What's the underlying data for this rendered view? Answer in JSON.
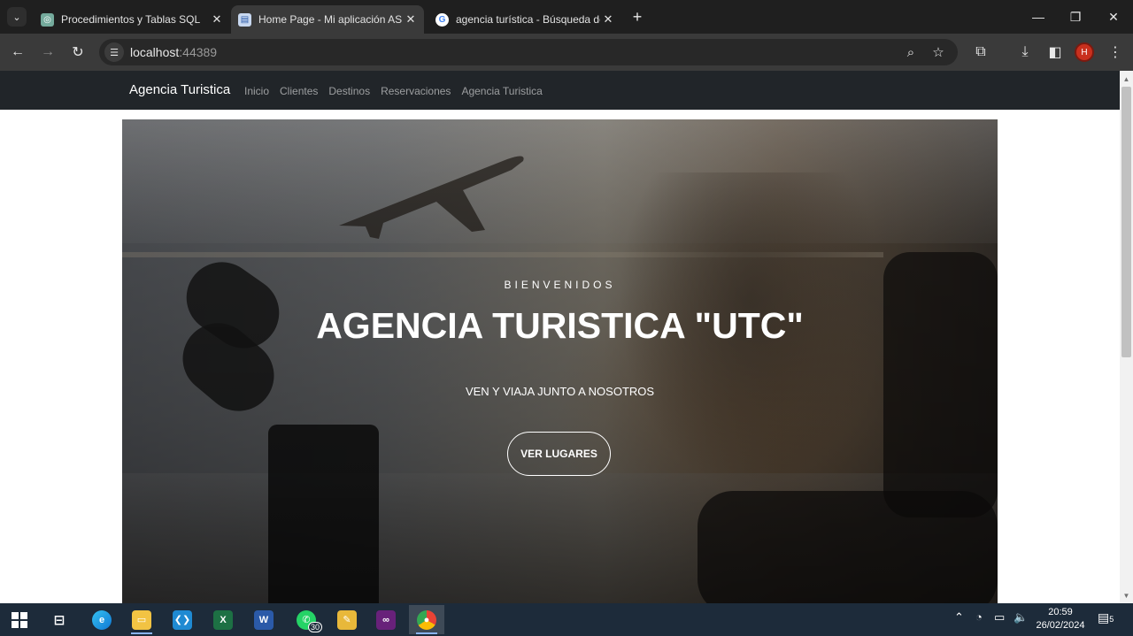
{
  "browser": {
    "tabs": [
      {
        "title": "Procedimientos y Tablas SQL",
        "favicon": "chatgpt-icon",
        "active": false
      },
      {
        "title": "Home Page - Mi aplicación ASP",
        "favicon": "page-icon",
        "active": true
      },
      {
        "title": "agencia turística - Búsqueda de",
        "favicon": "google-icon",
        "active": false
      }
    ],
    "close_glyph": "✕",
    "new_tab_glyph": "+",
    "address": {
      "host": "localhost",
      "port": ":44389"
    },
    "profile_initial": "H"
  },
  "site": {
    "brand": "Agencia Turistica",
    "nav": [
      "Inicio",
      "Clientes",
      "Destinos",
      "Reservaciones",
      "Agencia Turistica"
    ]
  },
  "hero": {
    "kicker": "BIENVENIDOS",
    "title": "AGENCIA TURISTICA \"UTC\"",
    "subtitle": "VEN Y VIAJA JUNTO A NOSOTROS",
    "cta": "VER LUGARES"
  },
  "taskbar": {
    "apps": [
      {
        "name": "task-view",
        "label": ""
      },
      {
        "name": "edge",
        "label": ""
      },
      {
        "name": "file-explorer",
        "label": ""
      },
      {
        "name": "vscode",
        "label": ""
      },
      {
        "name": "excel",
        "label": "X"
      },
      {
        "name": "word",
        "label": "W"
      },
      {
        "name": "whatsapp",
        "label": "",
        "badge": "30"
      },
      {
        "name": "sticky-app",
        "label": ""
      },
      {
        "name": "visual-studio",
        "label": ""
      },
      {
        "name": "chrome",
        "label": ""
      }
    ],
    "time": "20:59",
    "date": "26/02/2024",
    "notifications": "5"
  },
  "colors": {
    "navbar": "#212529",
    "tab_strip": "#1f1f1f",
    "toolbar": "#3a3a3a",
    "taskbar": "#1d2b3a",
    "profile": "#c9301e"
  }
}
